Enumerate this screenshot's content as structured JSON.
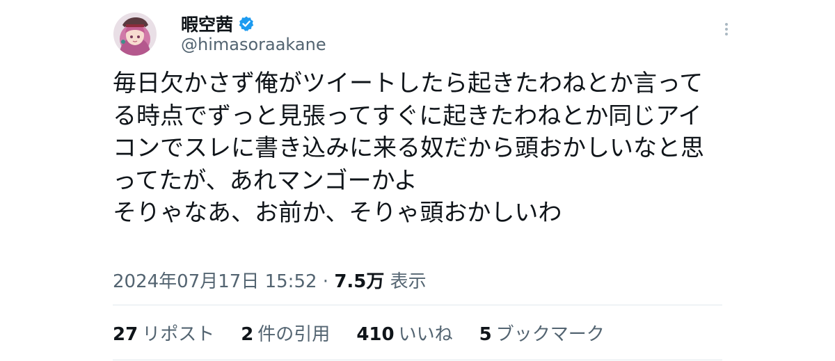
{
  "colors": {
    "primary_text": "#0f1419",
    "secondary_text": "#536471",
    "verified_badge": "#1d9bf0",
    "divider": "#e1e8ed"
  },
  "author": {
    "display_name": "暇空茜",
    "handle": "@himasoraakane",
    "verified": true,
    "avatar_icon": "anime-character-avatar"
  },
  "more_icon": "vertical-ellipsis-icon",
  "tweet": {
    "lines": [
      "毎日欠かさず俺がツイートしたら起きたわねとか言って",
      "る時点でずっと見張ってすぐに起きたわねとか同じアイ",
      "コンでスレに書き込みに来る奴だから頭おかしいなと思",
      "ってたが、あれマンゴーかよ",
      "そりゃなあ、お前か、そりゃ頭おかしいわ"
    ]
  },
  "meta": {
    "timestamp": "2024年07月17日 15:52",
    "separator": "·",
    "views_count": "7.5万",
    "views_label": "表示"
  },
  "stats": {
    "reposts": {
      "count": "27",
      "label": "リポスト"
    },
    "quotes": {
      "count": "2",
      "label": "件の引用"
    },
    "likes": {
      "count": "410",
      "label": "いいね"
    },
    "bookmarks": {
      "count": "5",
      "label": "ブックマーク"
    }
  }
}
